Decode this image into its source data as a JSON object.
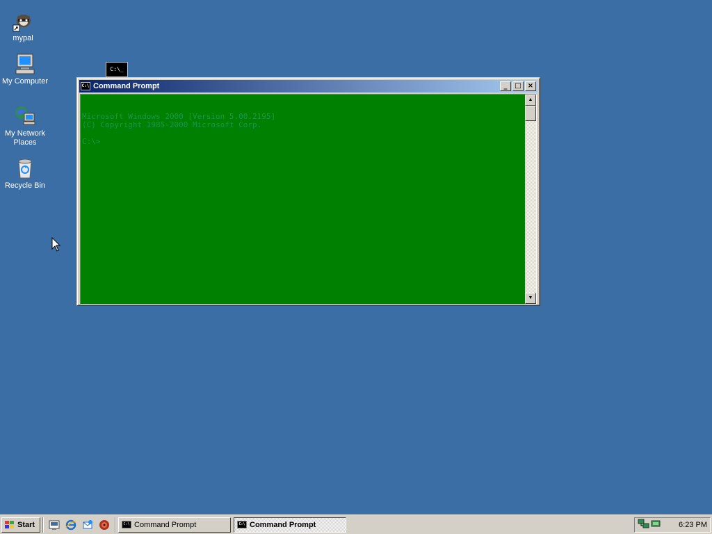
{
  "desktop": {
    "background_color": "#3a6ea5",
    "icons": [
      {
        "label": "mypal",
        "icon": "raccoon-shortcut-icon"
      },
      {
        "label": "My Computer",
        "icon": "computer-icon"
      },
      {
        "label": "My Network Places",
        "icon": "network-icon"
      },
      {
        "label": "Recycle Bin",
        "icon": "recycle-bin-icon"
      }
    ],
    "mini_cmd_text": "C:\\_"
  },
  "window": {
    "title": "Command Prompt",
    "icon_text": "C:\\",
    "minimize": "_",
    "maximize": "□",
    "close": "×",
    "console_background": "#008000",
    "console_lines": [
      "Microsoft Windows 2000 [Version 5.00.2195]",
      "(C) Copyright 1985-2000 Microsoft Corp.",
      "",
      "C:\\>"
    ]
  },
  "taskbar": {
    "start_label": "Start",
    "quick_launch": [
      "show-desktop-icon",
      "ie-icon",
      "outlook-icon",
      "media-player-icon"
    ],
    "tasks": [
      {
        "label": "Command Prompt",
        "active": false
      },
      {
        "label": "Command Prompt",
        "active": true
      }
    ],
    "tray_icons": [
      "network-tray-icon",
      "network-tray-icon-2"
    ],
    "clock": "6:23 PM"
  }
}
